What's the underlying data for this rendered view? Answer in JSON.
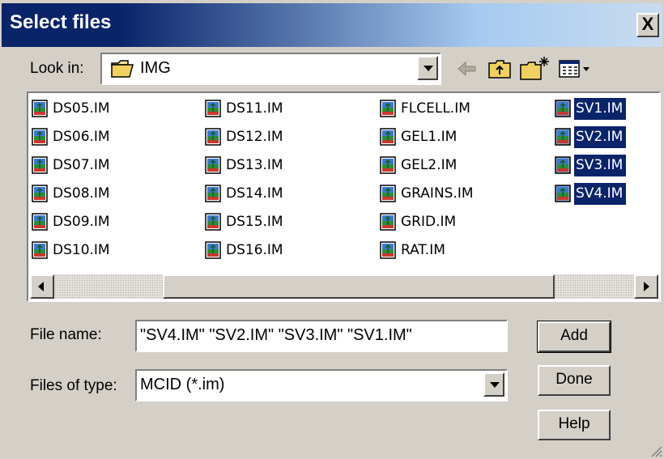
{
  "dialog": {
    "title": "Select files",
    "close_label": "X"
  },
  "look_in": {
    "label": "Look in:",
    "value": "IMG",
    "icon": "folder-icon"
  },
  "toolbar": {
    "back_icon": "back-arrow-icon",
    "up_icon": "up-folder-icon",
    "new_folder_icon": "new-folder-icon",
    "view_icon": "view-menu-icon"
  },
  "files": [
    {
      "name": "DS05.IM",
      "selected": false
    },
    {
      "name": "DS06.IM",
      "selected": false
    },
    {
      "name": "DS07.IM",
      "selected": false
    },
    {
      "name": "DS08.IM",
      "selected": false
    },
    {
      "name": "DS09.IM",
      "selected": false
    },
    {
      "name": "DS10.IM",
      "selected": false
    },
    {
      "name": "DS11.IM",
      "selected": false
    },
    {
      "name": "DS12.IM",
      "selected": false
    },
    {
      "name": "DS13.IM",
      "selected": false
    },
    {
      "name": "DS14.IM",
      "selected": false
    },
    {
      "name": "DS15.IM",
      "selected": false
    },
    {
      "name": "DS16.IM",
      "selected": false
    },
    {
      "name": "FLCELL.IM",
      "selected": false
    },
    {
      "name": "GEL1.IM",
      "selected": false
    },
    {
      "name": "GEL2.IM",
      "selected": false
    },
    {
      "name": "GRAINS.IM",
      "selected": false
    },
    {
      "name": "GRID.IM",
      "selected": false
    },
    {
      "name": "RAT.IM",
      "selected": false
    },
    {
      "name": "SV1.IM",
      "selected": true
    },
    {
      "name": "SV2.IM",
      "selected": true
    },
    {
      "name": "SV3.IM",
      "selected": true
    },
    {
      "name": "SV4.IM",
      "selected": true
    }
  ],
  "file_name": {
    "label": "File name:",
    "value": "\"SV4.IM\" \"SV2.IM\" \"SV3.IM\" \"SV1.IM\""
  },
  "file_type": {
    "label": "Files of type:",
    "value": "MCID (*.im)"
  },
  "buttons": {
    "add": "Add",
    "done": "Done",
    "help": "Help"
  },
  "colors": {
    "title_bar": "#0a246a",
    "selection": "#0a246a",
    "face": "#d4d0c8"
  }
}
